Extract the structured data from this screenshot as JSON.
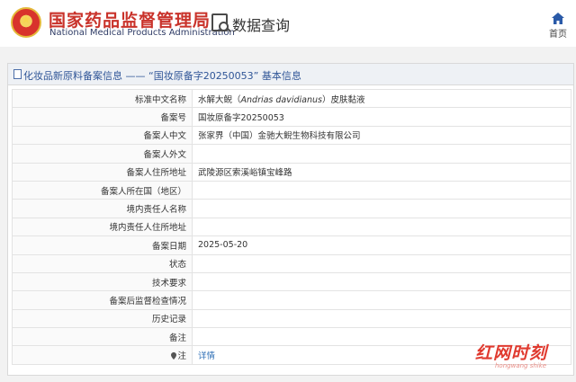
{
  "header": {
    "org_name_cn": "国家药品监督管理局",
    "org_name_en": "National Medical Products Administration",
    "query_title": "数据查询",
    "home_label": "首页",
    "icons": [
      "emblem-icon",
      "data-query-icon",
      "home-icon"
    ]
  },
  "panel": {
    "title": "化妆品新原料备案信息 —— “国妆原备字20250053” 基本信息"
  },
  "rows": [
    {
      "label": "标准中文名称",
      "value_pre": "水解大鲵（",
      "value_italic": "Andrias davidianus",
      "value_post": "）皮肤黏液"
    },
    {
      "label": "备案号",
      "value": "国妆原备字20250053"
    },
    {
      "label": "备案人中文",
      "value": "张家界（中国）金驰大鲵生物科技有限公司"
    },
    {
      "label": "备案人外文",
      "value": ""
    },
    {
      "label": "备案人住所地址",
      "value": "武陵源区索溪峪镇宝峰路"
    },
    {
      "label": "备案人所在国（地区）",
      "value": ""
    },
    {
      "label": "境内责任人名称",
      "value": ""
    },
    {
      "label": "境内责任人住所地址",
      "value": ""
    },
    {
      "label": "备案日期",
      "value": "2025-05-20"
    },
    {
      "label": "状态",
      "value": ""
    },
    {
      "label": "技术要求",
      "value": ""
    },
    {
      "label": "备案后监督检查情况",
      "value": ""
    },
    {
      "label": "历史记录",
      "value": ""
    },
    {
      "label": "备注",
      "value": ""
    },
    {
      "label": "注",
      "value": "详情"
    }
  ],
  "watermark": {
    "main": "红网时刻",
    "sub": "hongwang shike"
  },
  "colors": {
    "brand_red": "#c9322a",
    "link_blue": "#2f6fb6",
    "panel_title_blue": "#2f5597"
  }
}
